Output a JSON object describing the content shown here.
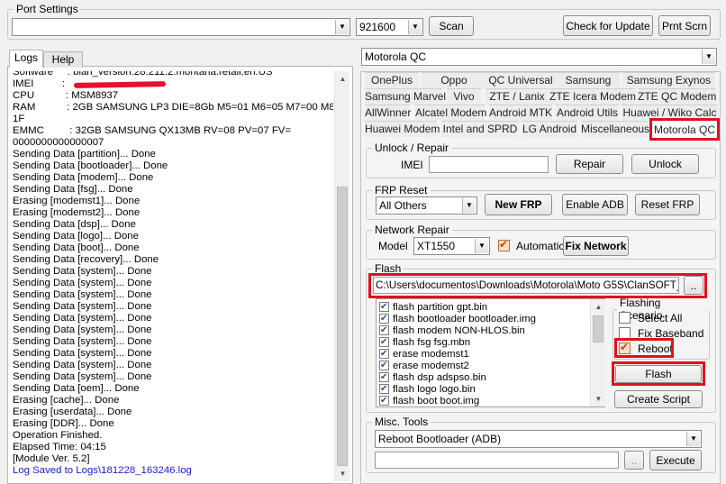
{
  "port_settings": {
    "legend": "Port Settings",
    "port_value": "",
    "baud_value": "921600",
    "scan_label": "Scan",
    "check_update_label": "Check for Update",
    "print_screen_label": "Prnt Scrn"
  },
  "left_tabs": [
    {
      "label": "Logs"
    },
    {
      "label": "Help"
    }
  ],
  "log_lines": [
    {
      "text": "Software     : blah_version:28.211.2.montana.retail.en.US"
    },
    {
      "text": "IMEI          : "
    },
    {
      "text": "CPU           : MSM8937"
    },
    {
      "text": "RAM           : 2GB SAMSUNG LP3 DIE=8Gb M5=01 M6=05 M7=00 M8="
    },
    {
      "text": "1F"
    },
    {
      "text": "EMMC         : 32GB SAMSUNG QX13MB RV=08 PV=07 FV="
    },
    {
      "text": "0000000000000007"
    },
    {
      "text": "Sending Data [partition]... Done"
    },
    {
      "text": "Sending Data [bootloader]... Done"
    },
    {
      "text": "Sending Data [modem]... Done"
    },
    {
      "text": "Sending Data [fsg]... Done"
    },
    {
      "text": "Erasing [modemst1]... Done"
    },
    {
      "text": "Erasing [modemst2]... Done"
    },
    {
      "text": "Sending Data [dsp]... Done"
    },
    {
      "text": "Sending Data [logo]... Done"
    },
    {
      "text": "Sending Data [boot]... Done"
    },
    {
      "text": "Sending Data [recovery]... Done"
    },
    {
      "text": "Sending Data [system]... Done"
    },
    {
      "text": "Sending Data [system]... Done"
    },
    {
      "text": "Sending Data [system]... Done"
    },
    {
      "text": "Sending Data [system]... Done"
    },
    {
      "text": "Sending Data [system]... Done"
    },
    {
      "text": "Sending Data [system]... Done"
    },
    {
      "text": "Sending Data [system]... Done"
    },
    {
      "text": "Sending Data [system]... Done"
    },
    {
      "text": "Sending Data [system]... Done"
    },
    {
      "text": "Sending Data [system]... Done"
    },
    {
      "text": "Sending Data [oem]... Done"
    },
    {
      "text": "Erasing [cache]... Done"
    },
    {
      "text": "Erasing [userdata]... Done"
    },
    {
      "text": "Erasing [DDR]... Done"
    },
    {
      "text": "Operation Finished."
    },
    {
      "text": "Elapsed Time: 04:15"
    },
    {
      "text": "[Module Ver. 5.2]"
    },
    {
      "text": "Log Saved to Logs\\181228_163246.log",
      "color": "blue"
    }
  ],
  "module_select": "Motorola QC",
  "tab_rows": [
    [
      "OnePlus",
      "Oppo",
      "QC Universal",
      "Samsung",
      "Samsung Exynos"
    ],
    [
      "Samsung Marvel",
      "Vivo",
      "ZTE / Lanix",
      "ZTE Icera Modem",
      "ZTE QC Modem"
    ],
    [
      "AllWinner",
      "Alcatel Modem",
      "Android MTK",
      "Android Utils",
      "Huawei / Wiko Calc"
    ],
    [
      "Huawei Modem",
      "Intel and SPRD",
      "LG Android",
      "Miscellaneous",
      "Motorola QC"
    ]
  ],
  "unlock": {
    "legend": "Unlock / Repair",
    "imei_label": "IMEI",
    "imei_value": "",
    "repair_label": "Repair",
    "unlock_label": "Unlock"
  },
  "frp": {
    "legend": "FRP Reset",
    "select_value": "All Others",
    "new_frp_label": "New FRP",
    "enable_adb_label": "Enable ADB",
    "reset_frp_label": "Reset FRP"
  },
  "network": {
    "legend": "Network Repair",
    "model_label": "Model",
    "model_value": "XT1550",
    "automatic_label": "Automatic",
    "fix_network_label": "Fix Network"
  },
  "flash": {
    "legend": "Flash",
    "path_value": "C:\\Users\\documentos\\Downloads\\Motorola\\Moto G5S\\ClanSOFT_M",
    "browse_label": "..",
    "items": [
      {
        "text": "flash  partition  gpt.bin",
        "checked": true
      },
      {
        "text": "flash  bootloader  bootloader.img",
        "checked": true
      },
      {
        "text": "flash  modem  NON-HLOS.bin",
        "checked": true
      },
      {
        "text": "flash  fsg  fsg.mbn",
        "checked": true
      },
      {
        "text": "erase  modemst1",
        "checked": true
      },
      {
        "text": "erase  modemst2",
        "checked": true
      },
      {
        "text": "flash  dsp  adspso.bin",
        "checked": true
      },
      {
        "text": "flash  logo  logo.bin",
        "checked": true
      },
      {
        "text": "flash  boot  boot.img",
        "checked": true
      }
    ],
    "scenario_legend": "Flashing Scenario",
    "select_all_label": "Select All",
    "fix_baseband_label": "Fix Baseband",
    "reboot_label": "Reboot",
    "flash_button_label": "Flash",
    "create_script_label": "Create Script"
  },
  "misc": {
    "legend": "Misc. Tools",
    "select_value": "Reboot Bootloader (ADB)",
    "input_value": "",
    "browse_label": "..",
    "execute_label": "Execute"
  },
  "colors": {
    "highlight_red": "#e0101e",
    "log_blue": "#1a1ad0",
    "redaction_red": "#e8102a"
  }
}
